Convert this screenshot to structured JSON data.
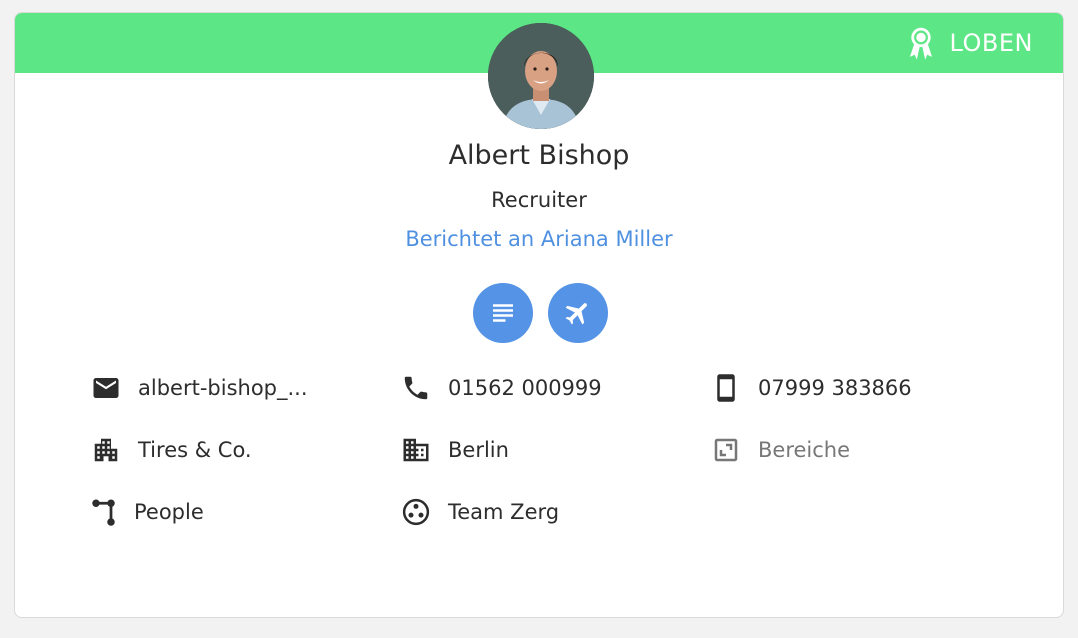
{
  "banner": {
    "praise_label": "LOBEN",
    "color": "#5ce685"
  },
  "profile": {
    "name": "Albert Bishop",
    "role": "Recruiter",
    "reports_to": "Berichtet an Ariana Miller"
  },
  "actions": [
    {
      "icon": "notes-icon"
    },
    {
      "icon": "airplane-icon"
    }
  ],
  "details": {
    "email": "albert-bishop_...",
    "phone": "01562 000999",
    "mobile": "07999 383866",
    "company": "Tires & Co.",
    "location": "Berlin",
    "areas": "Bereiche",
    "department": "People",
    "team": "Team Zerg"
  },
  "colors": {
    "accent": "#5493e6",
    "link": "#4f91e0",
    "banner": "#5ce685"
  }
}
